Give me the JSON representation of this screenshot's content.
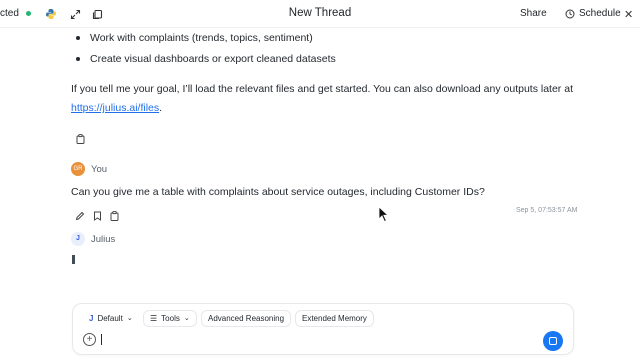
{
  "topbar": {
    "connection_status": "cted",
    "title": "New Thread",
    "share_label": "Share",
    "schedule_label": "Schedule"
  },
  "message_prev": {
    "bullets": [
      "Work with complaints (trends, topics, sentiment)",
      "Create visual dashboards or export cleaned datasets"
    ],
    "paragraph": "If you tell me your goal, I’ll load the relevant files and get started. You can also download any outputs later at",
    "link_text": "https://julius.ai/files",
    "link_suffix": "."
  },
  "user_message": {
    "avatar_initials": "GR",
    "author": "You",
    "text": "Can you give me a table with complaints about service outages, including Customer IDs?",
    "timestamp": "Sep 5, 07:53:57 AM"
  },
  "assistant_message": {
    "avatar_initial": "J",
    "author": "Julius"
  },
  "composer": {
    "model_label": "Default",
    "tools_label": "Tools",
    "advanced_reasoning_label": "Advanced Reasoning",
    "extended_memory_label": "Extended Memory",
    "input_value": ""
  },
  "colors": {
    "connected_dot": "#22b573",
    "link": "#1f6feb",
    "user_avatar": "#e8913a",
    "send_button": "#1877f2"
  }
}
